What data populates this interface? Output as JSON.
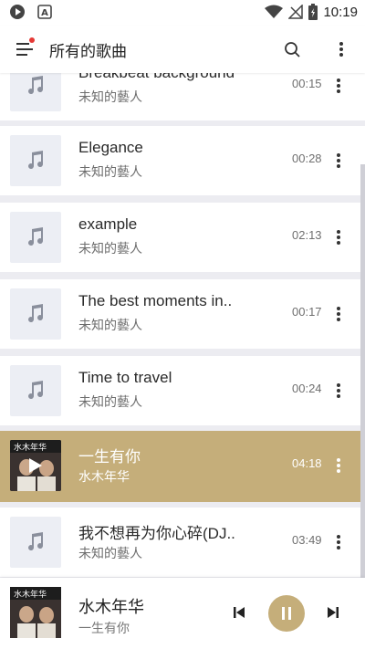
{
  "status_bar": {
    "time": "10:19"
  },
  "app_bar": {
    "title": "所有的歌曲"
  },
  "songs": [
    {
      "title": "Breakbeat background",
      "artist": "未知的藝人",
      "duration": "00:15"
    },
    {
      "title": "Elegance",
      "artist": "未知的藝人",
      "duration": "00:28"
    },
    {
      "title": "example",
      "artist": "未知的藝人",
      "duration": "02:13"
    },
    {
      "title": "The best moments in..",
      "artist": "未知的藝人",
      "duration": "00:17"
    },
    {
      "title": "Time to travel",
      "artist": "未知的藝人",
      "duration": "00:24"
    },
    {
      "title": "一生有你",
      "artist": "水木年华",
      "duration": "04:18",
      "playing": true
    },
    {
      "title": "我不想再为你心碎(DJ..",
      "artist": "未知的藝人",
      "duration": "03:49"
    }
  ],
  "now_playing": {
    "title": "水木年华",
    "artist": "一生有你"
  },
  "album_art_text": "水木年华",
  "colors": {
    "accent": "#c5ae7a",
    "thumb_bg": "#eceef4",
    "notification_dot": "#e53935"
  }
}
